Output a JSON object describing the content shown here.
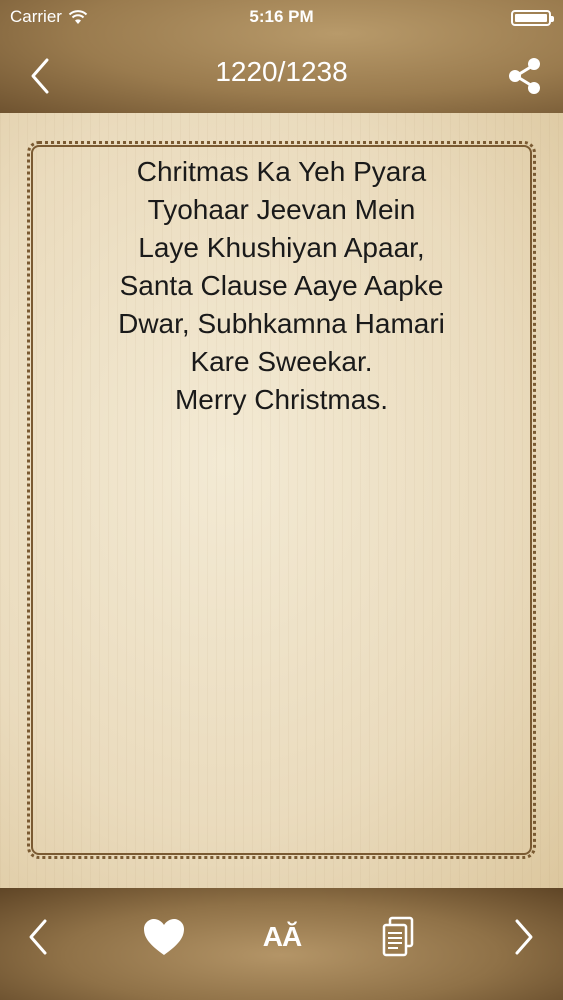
{
  "status_bar": {
    "carrier": "Carrier",
    "time": "5:16 PM"
  },
  "nav": {
    "title": "1220/1238",
    "back_icon": "chevron-left-icon",
    "share_icon": "share-icon"
  },
  "quote": {
    "text": "Chritmas Ka Yeh Pyara\nTyohaar Jeevan Mein\nLaye Khushiyan Apaar,\nSanta Clause Aaye Aapke\nDwar, Subhkamna Hamari\nKare Sweekar.\nMerry Christmas."
  },
  "toolbar": {
    "font_label": "AĂ",
    "icons": [
      "chevron-left-icon",
      "heart-icon",
      "font-size-icon",
      "copy-icon",
      "chevron-right-icon"
    ]
  },
  "colors": {
    "card_border": "#7a5a32",
    "text": "#1a1a1a",
    "bar_text": "#ffffff"
  }
}
